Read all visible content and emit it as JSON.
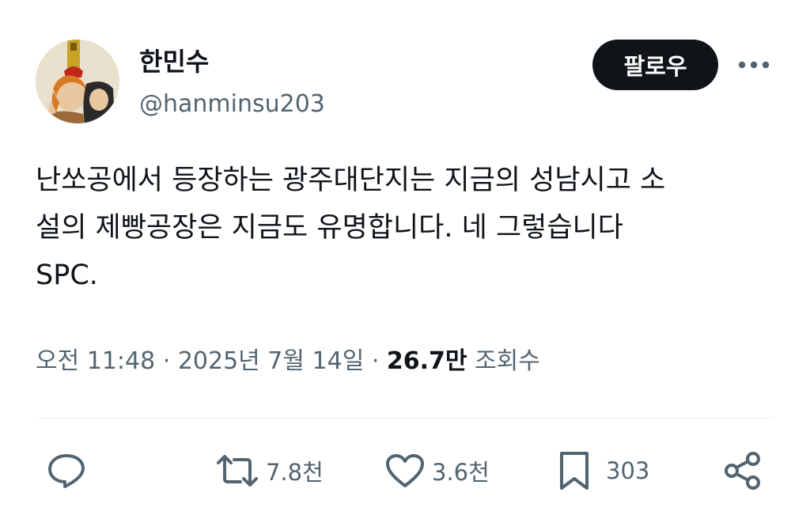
{
  "author": {
    "display_name": "한민수",
    "handle": "@hanminsu203",
    "avatar_icon": "medieval-illustration-avatar"
  },
  "header": {
    "follow_label": "팔로우",
    "more_icon": "ellipsis-icon"
  },
  "tweet": {
    "text": "난쏘공에서 등장하는 광주대단지는 지금의 성남시고 소\n설의 제빵공장은 지금도 유명합니다. 네 그렇습니다\nSPC."
  },
  "meta": {
    "time": "오전 11:48",
    "separator": " · ",
    "date": "2025년 7월 14일",
    "views_count": "26.7만",
    "views_label": "조회수"
  },
  "actions": {
    "reply_icon": "reply-icon",
    "retweet_icon": "retweet-icon",
    "retweet_count": "7.8천",
    "like_icon": "heart-icon",
    "like_count": "3.6천",
    "bookmark_icon": "bookmark-icon",
    "bookmark_count": "303",
    "share_icon": "share-icon"
  },
  "colors": {
    "text_primary": "#0f1419",
    "text_secondary": "#536471",
    "button_bg": "#0f1419",
    "divider": "#eff3f4"
  }
}
